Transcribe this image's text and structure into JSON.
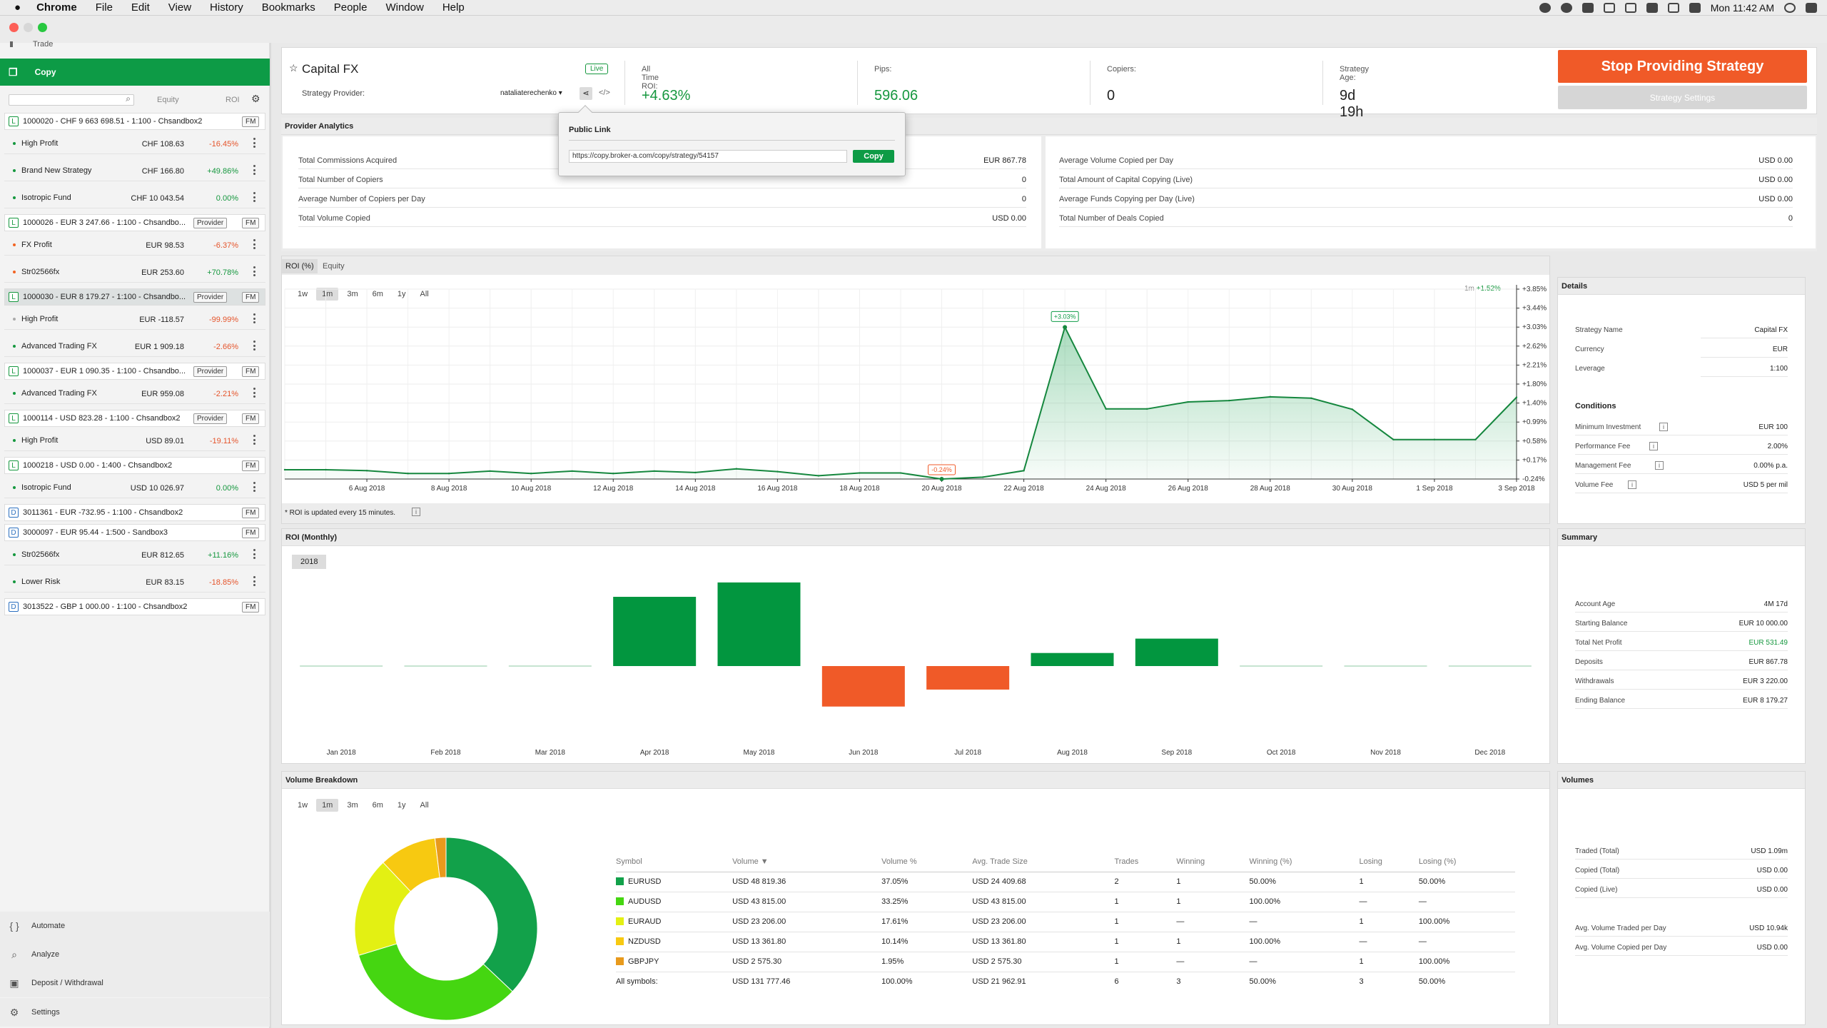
{
  "menubar": {
    "apple": "",
    "app": "Chrome",
    "items": [
      "File",
      "Edit",
      "View",
      "History",
      "Bookmarks",
      "People",
      "Window",
      "Help"
    ],
    "clock": "Mon 11:42 AM"
  },
  "sidebar": {
    "trade_label": "Trade",
    "copy_label": "Copy",
    "col_equity": "Equity",
    "col_roi": "ROI",
    "tags": {
      "provider": "Provider",
      "fm": "FM"
    },
    "rows": [
      {
        "kind": "acc",
        "badge": "L",
        "text": "1000020 - CHF 9 663 698.51 - 1:100 - Chsandbox2",
        "fm": true
      },
      {
        "kind": "strat",
        "name": "High Profit",
        "equity": "CHF 108.63",
        "roi": "-16.45%",
        "sign": "neg"
      },
      {
        "kind": "strat",
        "name": "Brand New Strategy",
        "equity": "CHF 166.80",
        "roi": "+49.86%",
        "sign": "pos"
      },
      {
        "kind": "strat",
        "name": "Isotropic Fund",
        "equity": "CHF 10 043.54",
        "roi": "0.00%",
        "sign": "pos"
      },
      {
        "kind": "acc",
        "badge": "L",
        "text": "1000026 - EUR 3 247.66 - 1:100 - Chsandbo...",
        "provider": true,
        "fm": true
      },
      {
        "kind": "strat",
        "name": "FX Profit",
        "equity": "EUR 98.53",
        "roi": "-6.37%",
        "sign": "neg",
        "dotc": "o"
      },
      {
        "kind": "strat",
        "name": "Str02566fx",
        "equity": "EUR 253.60",
        "roi": "+70.78%",
        "sign": "pos",
        "dotc": "o"
      },
      {
        "kind": "acc",
        "badge": "L",
        "text": "1000030 - EUR 8 179.27 - 1:100 - Chsandbo...",
        "provider": true,
        "fm": true,
        "sel": true
      },
      {
        "kind": "strat",
        "name": "High Profit",
        "equity": "EUR -118.57",
        "roi": "-99.99%",
        "sign": "neg",
        "dotc": "g"
      },
      {
        "kind": "strat",
        "name": "Advanced Trading FX",
        "equity": "EUR 1 909.18",
        "roi": "-2.66%",
        "sign": "neg"
      },
      {
        "kind": "acc",
        "badge": "L",
        "text": "1000037 - EUR 1 090.35 - 1:100 - Chsandbo...",
        "provider": true,
        "fm": true
      },
      {
        "kind": "strat",
        "name": "Advanced Trading FX",
        "equity": "EUR 959.08",
        "roi": "-2.21%",
        "sign": "neg"
      },
      {
        "kind": "acc",
        "badge": "L",
        "text": "1000114 - USD 823.28 - 1:100 - Chsandbox2",
        "provider": true,
        "fm": true
      },
      {
        "kind": "strat",
        "name": "High Profit",
        "equity": "USD 89.01",
        "roi": "-19.11%",
        "sign": "neg"
      },
      {
        "kind": "acc",
        "badge": "L",
        "text": "1000218 - USD 0.00 - 1:400 - Chsandbox2",
        "fm": true
      },
      {
        "kind": "strat",
        "name": "Isotropic Fund",
        "equity": "USD 10 026.97",
        "roi": "0.00%",
        "sign": "pos"
      },
      {
        "kind": "acc",
        "badge": "D",
        "text": "3011361 - EUR -732.95 - 1:100 - Chsandbox2",
        "fm": true,
        "demo": true
      },
      {
        "kind": "acc",
        "badge": "D",
        "text": "3000097 - EUR 95.44 - 1:500 - Sandbox3",
        "fm": true,
        "demo": true
      },
      {
        "kind": "strat",
        "name": "Str02566fx",
        "equity": "EUR 812.65",
        "roi": "+11.16%",
        "sign": "pos"
      },
      {
        "kind": "strat",
        "name": "Lower Risk",
        "equity": "EUR 83.15",
        "roi": "-18.85%",
        "sign": "neg"
      },
      {
        "kind": "acc",
        "badge": "D",
        "text": "3013522 - GBP 1 000.00 - 1:100 - Chsandbox2",
        "fm": true,
        "demo": true
      }
    ],
    "bottom": [
      {
        "label": "Automate",
        "icon": "code-braces-icon",
        "glyph": "{ }"
      },
      {
        "label": "Analyze",
        "icon": "magnifier-icon",
        "glyph": "⌕"
      },
      {
        "label": "Deposit / Withdrawal",
        "icon": "wallet-icon",
        "glyph": "▣"
      },
      {
        "label": "Settings",
        "icon": "gear-icon",
        "glyph": "⚙"
      }
    ]
  },
  "header": {
    "strategy_name": "Capital FX",
    "live_badge": "Live",
    "provider_label": "Strategy Provider:",
    "provider_name": "nataliaterechenko",
    "stats": [
      {
        "label": "All Time ROI:",
        "value": "+4.63%",
        "green": true
      },
      {
        "label": "Pips:",
        "value": "596.06",
        "green": true
      },
      {
        "label": "Copiers:",
        "value": "0",
        "green": false
      },
      {
        "label": "Strategy Age:",
        "value": "9d 19h",
        "green": false
      }
    ],
    "stop_button": "Stop Providing Strategy",
    "settings_button": "Strategy Settings"
  },
  "popup": {
    "title": "Public Link",
    "url": "https://copy.broker-a.com/copy/strategy/54157",
    "copy_button": "Copy"
  },
  "analytics": {
    "title": "Provider Analytics",
    "left": [
      {
        "label": "Total Commissions Acquired",
        "value": "EUR 867.78"
      },
      {
        "label": "Total Number of Copiers",
        "value": "0"
      },
      {
        "label": "Average Number of Copiers per Day",
        "value": "0"
      },
      {
        "label": "Total Volume Copied",
        "value": "USD 0.00"
      }
    ],
    "right": [
      {
        "label": "Average Volume Copied per Day",
        "value": "USD 0.00"
      },
      {
        "label": "Total Amount of Capital Copying (Live)",
        "value": "USD 0.00"
      },
      {
        "label": "Average Funds Copying per Day (Live)",
        "value": "USD 0.00"
      },
      {
        "label": "Total Number of Deals Copied",
        "value": "0"
      }
    ]
  },
  "roi_chart": {
    "tabs": [
      "ROI (%)",
      "Equity"
    ],
    "ranges": [
      "1w",
      "1m",
      "3m",
      "6m",
      "1y",
      "All"
    ],
    "active_range": "1m",
    "period_label": "1m",
    "period_value": "+1.52%",
    "footnote": "* ROI is updated every 15 minutes.",
    "footnote_icon": "i"
  },
  "monthly": {
    "title": "ROI (Monthly)",
    "year": "2018"
  },
  "details": {
    "title": "Details",
    "rows": [
      {
        "label": "Strategy Name",
        "value": "Capital FX"
      },
      {
        "label": "Currency",
        "value": "EUR"
      },
      {
        "label": "Leverage",
        "value": "1:100"
      }
    ],
    "conditions_title": "Conditions",
    "conditions": [
      {
        "label": "Minimum Investment",
        "value": "EUR 100"
      },
      {
        "label": "Performance Fee",
        "value": "2.00%"
      },
      {
        "label": "Management Fee",
        "value": "0.00% p.a."
      },
      {
        "label": "Volume Fee",
        "value": "USD 5 per mil"
      }
    ]
  },
  "summary": {
    "title": "Summary",
    "rows": [
      {
        "label": "Account Age",
        "value": "4M 17d"
      },
      {
        "label": "Starting Balance",
        "value": "EUR 10 000.00"
      },
      {
        "label": "Total Net Profit",
        "value": "EUR 531.49",
        "green": true
      },
      {
        "label": "Deposits",
        "value": "EUR 867.78"
      },
      {
        "label": "Withdrawals",
        "value": "EUR 3 220.00"
      },
      {
        "label": "Ending Balance",
        "value": "EUR 8 179.27"
      }
    ]
  },
  "volume": {
    "title": "Volume Breakdown",
    "ranges": [
      "1w",
      "1m",
      "3m",
      "6m",
      "1y",
      "All"
    ],
    "active_range": "1m",
    "columns": [
      "Symbol",
      "Volume ▼",
      "Volume %",
      "Avg. Trade Size",
      "Trades",
      "Winning",
      "Winning (%)",
      "Losing",
      "Losing (%)"
    ],
    "rows": [
      {
        "color": "#12a14a",
        "cells": [
          "EURUSD",
          "USD 48 819.36",
          "37.05%",
          "USD 24 409.68",
          "2",
          "1",
          "50.00%",
          "1",
          "50.00%"
        ]
      },
      {
        "color": "#45d611",
        "cells": [
          "AUDUSD",
          "USD 43 815.00",
          "33.25%",
          "USD 43 815.00",
          "1",
          "1",
          "100.00%",
          "—",
          "—"
        ]
      },
      {
        "color": "#e3f013",
        "cells": [
          "EURAUD",
          "USD 23 206.00",
          "17.61%",
          "USD 23 206.00",
          "1",
          "—",
          "—",
          "1",
          "100.00%"
        ]
      },
      {
        "color": "#f7c911",
        "cells": [
          "NZDUSD",
          "USD 13 361.80",
          "10.14%",
          "USD 13 361.80",
          "1",
          "1",
          "100.00%",
          "—",
          "—"
        ]
      },
      {
        "color": "#e89a1c",
        "cells": [
          "GBPJPY",
          "USD 2 575.30",
          "1.95%",
          "USD 2 575.30",
          "1",
          "—",
          "—",
          "1",
          "100.00%"
        ]
      }
    ],
    "total": [
      "All symbols:",
      "USD 131 777.46",
      "100.00%",
      "USD 21 962.91",
      "6",
      "3",
      "50.00%",
      "3",
      "50.00%"
    ]
  },
  "volumes": {
    "title": "Volumes",
    "rows": [
      {
        "label": "Traded (Total)",
        "value": "USD 1.09m"
      },
      {
        "label": "Copied (Total)",
        "value": "USD 0.00"
      },
      {
        "label": "Copied (Live)",
        "value": "USD 0.00"
      },
      {
        "label": "Avg. Volume Traded per Day",
        "value": "USD 10.94k"
      },
      {
        "label": "Avg. Volume Copied per Day",
        "value": "USD 0.00"
      }
    ]
  },
  "chart_data": [
    {
      "type": "area",
      "title": "ROI (%)",
      "x": [
        "4 Aug",
        "5 Aug",
        "6 Aug",
        "7 Aug",
        "8 Aug",
        "9 Aug",
        "10 Aug",
        "11 Aug",
        "12 Aug",
        "13 Aug",
        "14 Aug",
        "15 Aug",
        "16 Aug",
        "17 Aug",
        "18 Aug",
        "19 Aug",
        "20 Aug",
        "21 Aug",
        "22 Aug",
        "23 Aug",
        "24 Aug",
        "25 Aug",
        "26 Aug",
        "27 Aug",
        "28 Aug",
        "29 Aug",
        "30 Aug",
        "31 Aug",
        "1 Sep",
        "2 Sep",
        "3 Sep"
      ],
      "values": [
        -0.04,
        -0.04,
        -0.06,
        -0.12,
        -0.12,
        -0.07,
        -0.12,
        -0.07,
        -0.12,
        -0.07,
        -0.1,
        -0.02,
        -0.08,
        -0.17,
        -0.11,
        -0.11,
        -0.24,
        -0.2,
        -0.06,
        3.03,
        1.27,
        1.27,
        1.42,
        1.45,
        1.53,
        1.5,
        1.26,
        0.61,
        0.61,
        0.61,
        1.52
      ],
      "xticks": [
        "6 Aug 2018",
        "8 Aug 2018",
        "10 Aug 2018",
        "12 Aug 2018",
        "14 Aug 2018",
        "16 Aug 2018",
        "18 Aug 2018",
        "20 Aug 2018",
        "22 Aug 2018",
        "24 Aug 2018",
        "26 Aug 2018",
        "28 Aug 2018",
        "30 Aug 2018",
        "1 Sep 2018",
        "3 Sep 2018"
      ],
      "yticks": [
        "+3.85%",
        "+3.44%",
        "+3.03%",
        "+2.62%",
        "+2.21%",
        "+1.80%",
        "+1.40%",
        "+0.99%",
        "+0.58%",
        "+0.17%",
        "-0.24%"
      ],
      "ylim": [
        -0.24,
        3.85
      ],
      "annotations": [
        {
          "x": "23 Aug",
          "label": "+3.03%"
        },
        {
          "x": "20 Aug",
          "label": "-0.24%"
        }
      ],
      "grid": true
    },
    {
      "type": "bar",
      "title": "ROI (Monthly)",
      "categories": [
        "Jan 2018",
        "Feb 2018",
        "Mar 2018",
        "Apr 2018",
        "May 2018",
        "Jun 2018",
        "Jul 2018",
        "Aug 2018",
        "Sep 2018",
        "Oct 2018",
        "Nov 2018",
        "Dec 2018"
      ],
      "values": [
        0,
        0,
        0,
        5.3,
        6.4,
        -3.1,
        -1.8,
        1.0,
        2.1,
        0,
        0,
        0
      ],
      "colors": {
        "positive": "#02963f",
        "negative": "#f05a28"
      }
    },
    {
      "type": "pie",
      "title": "Volume Breakdown",
      "categories": [
        "EURUSD",
        "AUDUSD",
        "EURAUD",
        "NZDUSD",
        "GBPJPY"
      ],
      "values": [
        37.05,
        33.25,
        17.61,
        10.14,
        1.95
      ],
      "colors": [
        "#12a14a",
        "#45d611",
        "#e3f013",
        "#f7c911",
        "#e89a1c"
      ]
    }
  ]
}
